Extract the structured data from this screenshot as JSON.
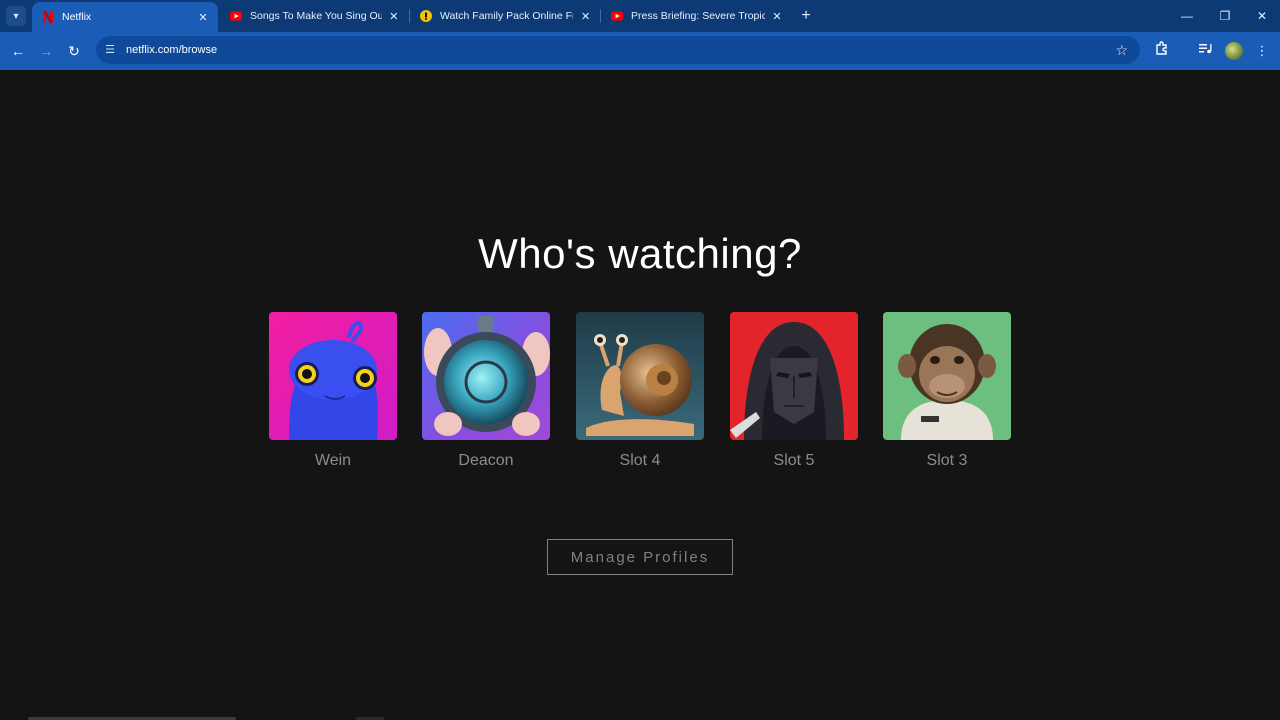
{
  "browser": {
    "tabs": [
      {
        "title": "Netflix",
        "favicon": "netflix-icon",
        "active": true
      },
      {
        "title": "Songs To Make You Sing Out Lo",
        "favicon": "youtube-icon",
        "active": false
      },
      {
        "title": "Watch Family Pack Online Free",
        "favicon": "site-icon",
        "active": false
      },
      {
        "title": "Press Briefing: Severe Tropical S",
        "favicon": "youtube-icon",
        "active": false
      }
    ],
    "url": "netflix.com/browse",
    "colors": {
      "chrome": "#1a5cb6",
      "tabstrip": "#0d3a75"
    }
  },
  "page": {
    "heading": "Who's watching?",
    "profiles": [
      {
        "name": "Wein",
        "avatar": "blue-lizard-avatar",
        "bg": "#e91e8c"
      },
      {
        "name": "Deacon",
        "avatar": "pocket-watch-avatar",
        "bg": "#6a4bd6"
      },
      {
        "name": "Slot 4",
        "avatar": "snail-avatar",
        "bg": "#2a4a58"
      },
      {
        "name": "Slot 5",
        "avatar": "masked-guard-avatar",
        "bg": "#e3252b"
      },
      {
        "name": "Slot 3",
        "avatar": "chimp-avatar",
        "bg": "#6cbf7e"
      }
    ],
    "manage_label": "Manage Profiles",
    "colors": {
      "background": "#141414",
      "text_dim": "#808080"
    }
  }
}
